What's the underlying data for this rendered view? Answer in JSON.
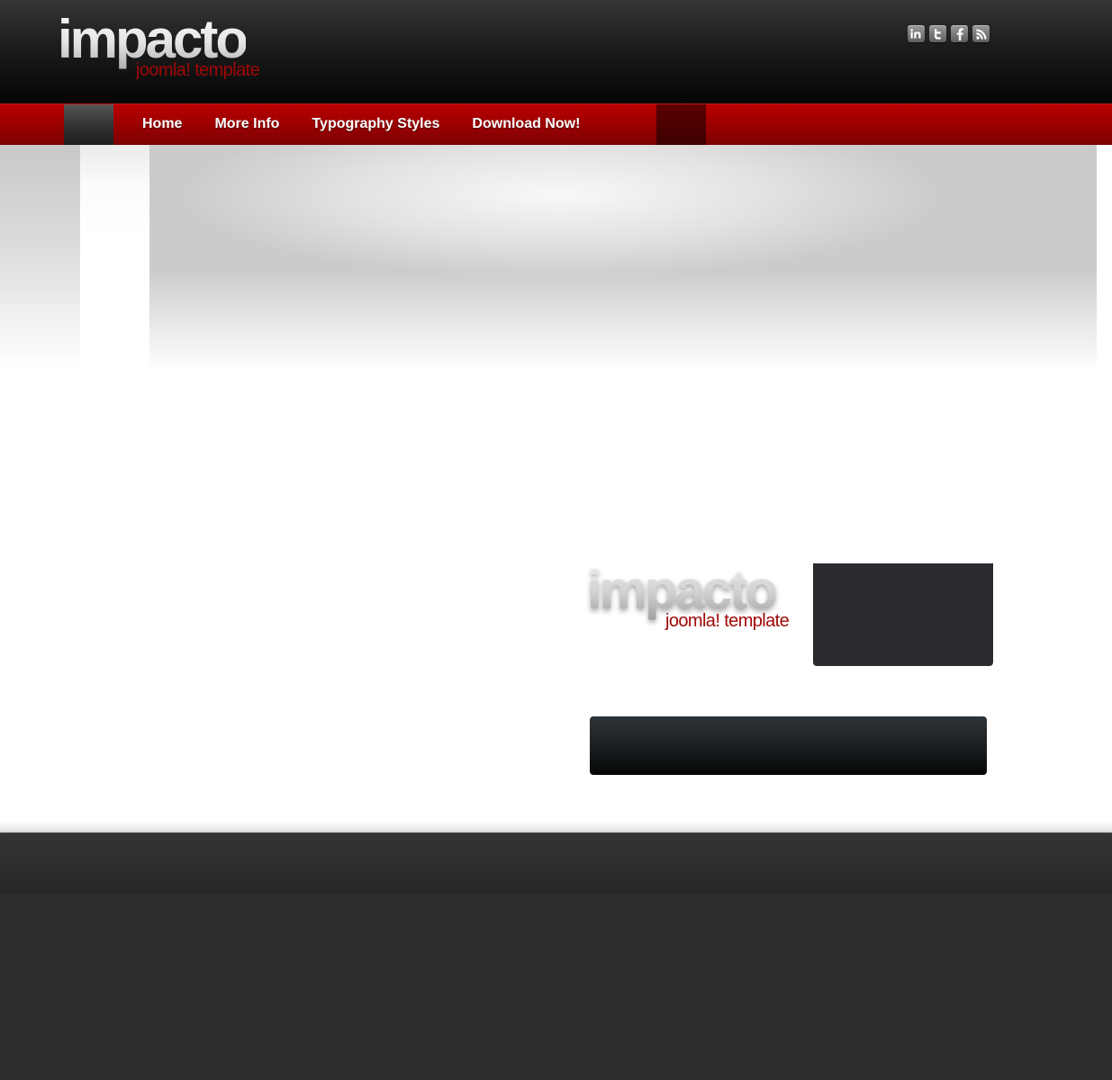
{
  "header": {
    "logo": {
      "main": "impacto",
      "sub": "joomla! template"
    },
    "social": [
      {
        "name": "linkedin",
        "icon": "linkedin-icon"
      },
      {
        "name": "twitter",
        "icon": "twitter-icon"
      },
      {
        "name": "facebook",
        "icon": "facebook-icon"
      },
      {
        "name": "rss",
        "icon": "rss-icon"
      }
    ]
  },
  "nav": {
    "items": [
      {
        "label": "Home"
      },
      {
        "label": "More Info"
      },
      {
        "label": "Typography Styles"
      },
      {
        "label": "Download Now!"
      }
    ]
  },
  "content": {
    "logo": {
      "main": "impacto",
      "sub": "joomla! template"
    }
  },
  "colors": {
    "accent_red": "#9b0000",
    "header_dark": "#1c1c1c",
    "footer_dark": "#2d2d2b",
    "panel_dark": "#292b2e"
  }
}
